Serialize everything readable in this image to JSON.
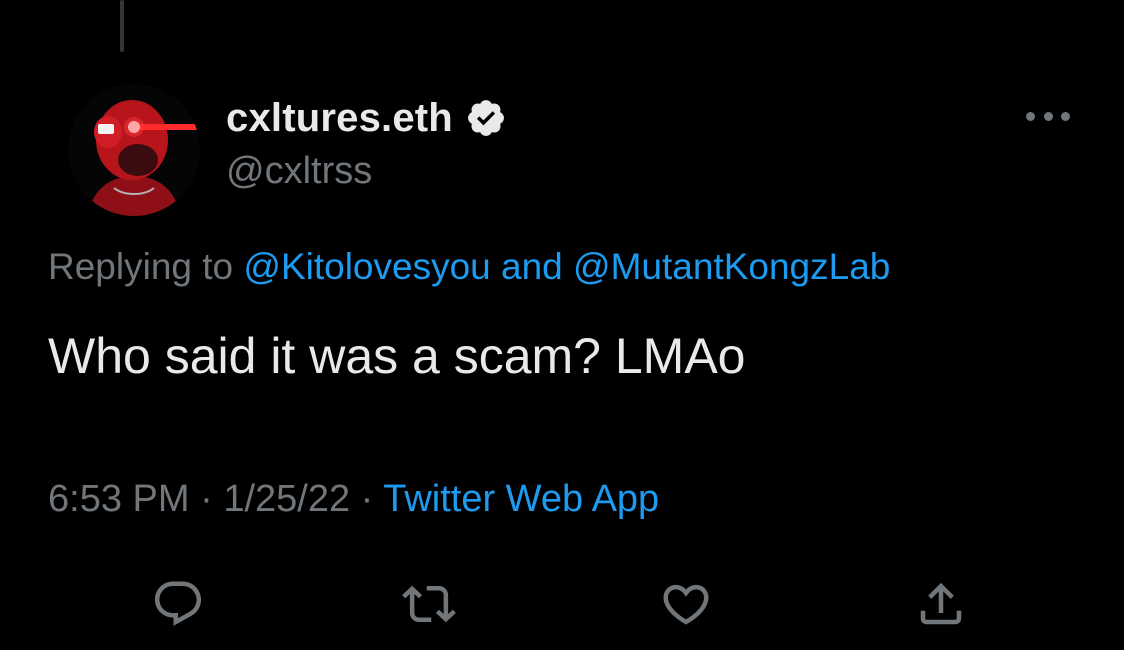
{
  "tweet": {
    "author": {
      "display_name": "cxltures.eth",
      "handle": "@cxltrss",
      "verified": true,
      "avatar_icon": "red-ape-avatar-icon"
    },
    "replying": {
      "prefix": "Replying to ",
      "mention_1": "@Kitolovesyou",
      "joiner": " and ",
      "mention_2": "@MutantKongzLab"
    },
    "text": "Who said it was a scam? LMAo",
    "time": "6:53 PM",
    "separator": " · ",
    "date": "1/25/22",
    "source": "Twitter Web App"
  },
  "actions": [
    {
      "name": "reply",
      "icon": "reply-icon"
    },
    {
      "name": "retweet",
      "icon": "retweet-icon"
    },
    {
      "name": "like",
      "icon": "heart-icon"
    },
    {
      "name": "share",
      "icon": "share-icon"
    }
  ],
  "colors": {
    "background": "#000000",
    "primary_text": "#e7e9ea",
    "secondary_text": "#71767b",
    "accent": "#1d9bf0"
  }
}
